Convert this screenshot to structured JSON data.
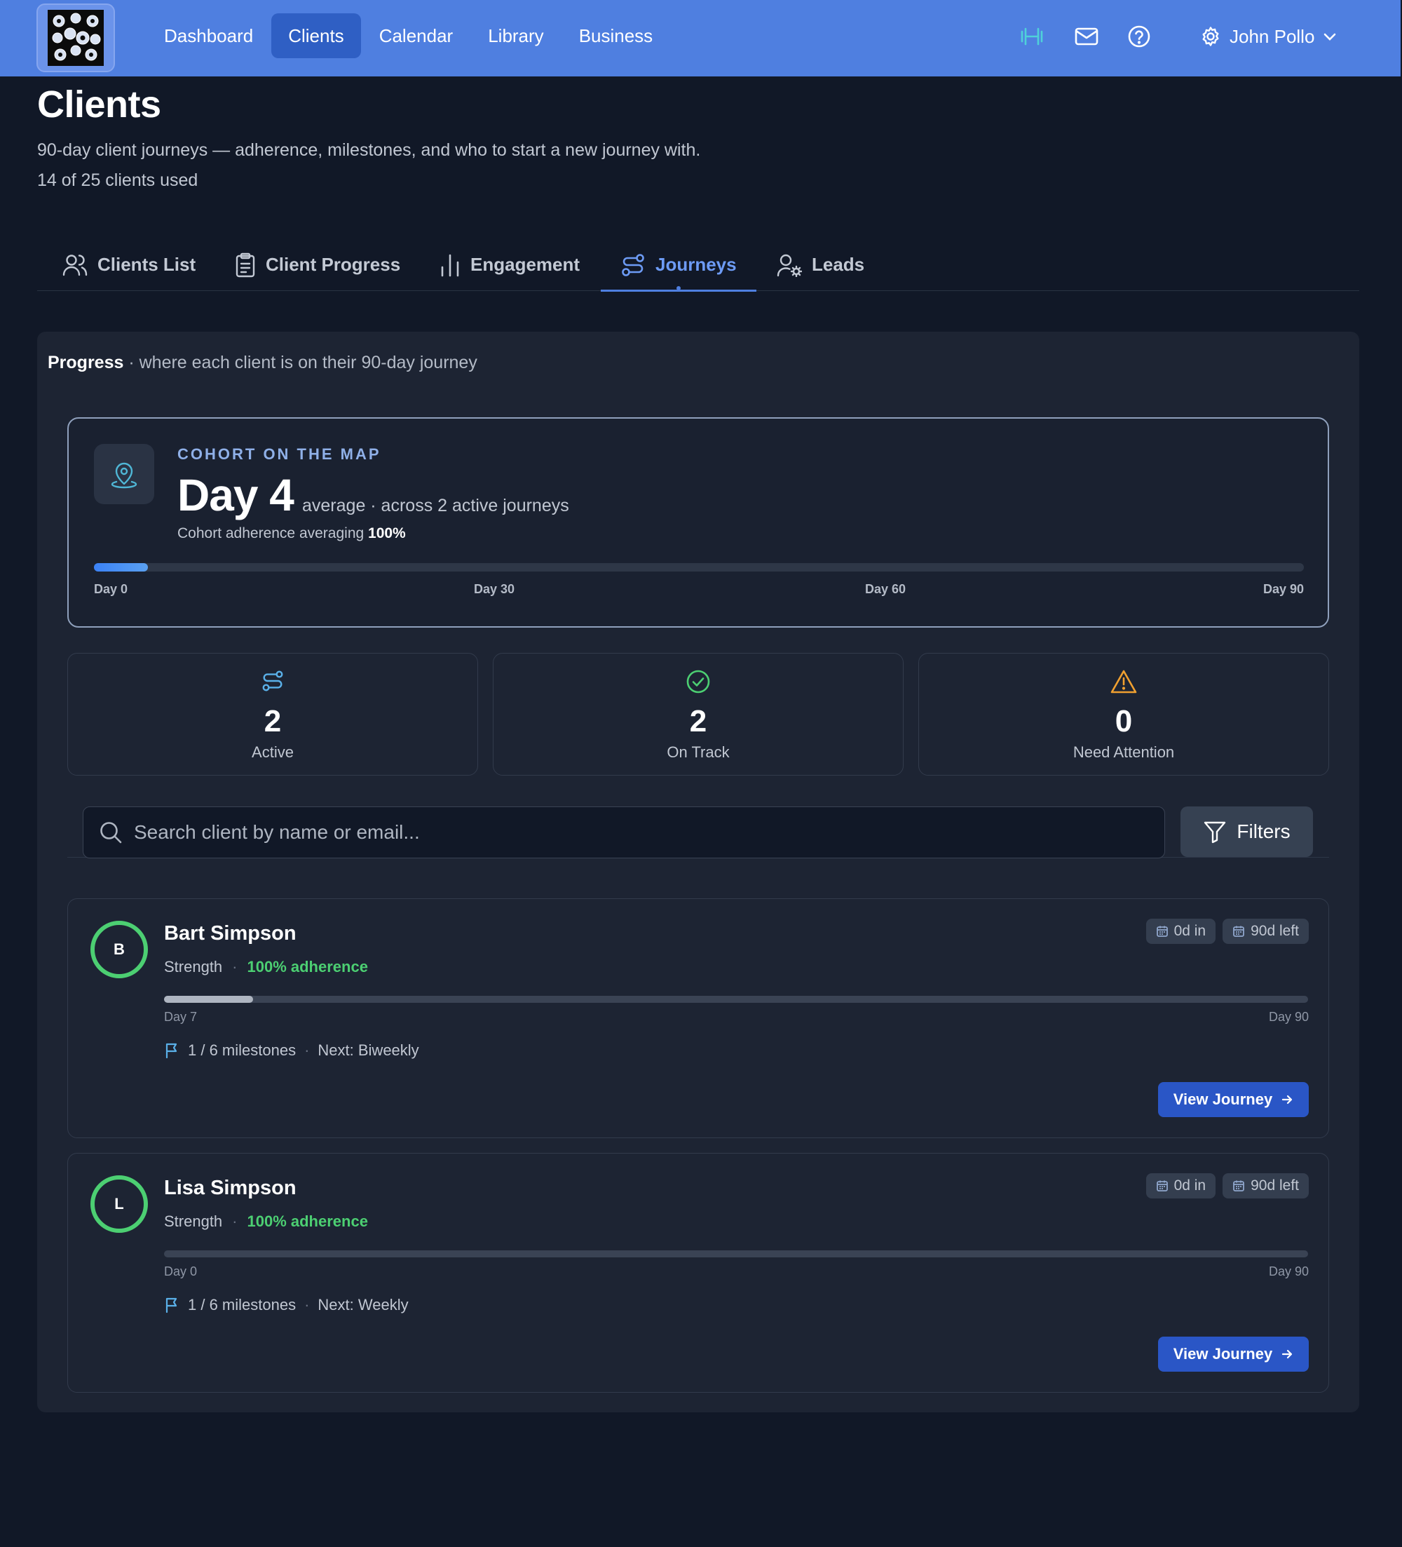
{
  "nav": {
    "items": [
      {
        "label": "Dashboard",
        "active": false
      },
      {
        "label": "Clients",
        "active": true
      },
      {
        "label": "Calendar",
        "active": false
      },
      {
        "label": "Library",
        "active": false
      },
      {
        "label": "Business",
        "active": false
      }
    ],
    "icons": [
      "dumbbell-icon",
      "mail-icon",
      "help-icon"
    ],
    "user": {
      "name": "John Pollo",
      "icon": "gear-icon"
    }
  },
  "header": {
    "title": "Clients",
    "subtitle": "90-day client journeys — adherence, milestones, and who to start a new journey with.",
    "usage": "14 of 25 clients used"
  },
  "tabs": [
    {
      "label": "Clients List",
      "icon": "users-icon",
      "active": false
    },
    {
      "label": "Client Progress",
      "icon": "clipboard-icon",
      "active": false
    },
    {
      "label": "Engagement",
      "icon": "bar-chart-icon",
      "active": false
    },
    {
      "label": "Journeys",
      "icon": "route-icon",
      "active": true
    },
    {
      "label": "Leads",
      "icon": "user-cog-icon",
      "active": false
    }
  ],
  "progress": {
    "heading_bold": "Progress",
    "heading_rest": " · where each client is on their 90-day journey"
  },
  "cohort": {
    "kicker": "COHORT ON THE MAP",
    "big": "Day 4",
    "meta": "average · across 2 active journeys",
    "adherence_prefix": "Cohort adherence averaging ",
    "adherence_value": "100%",
    "average_day": 4,
    "total_days": 90,
    "ticks": [
      "Day 0",
      "Day 30",
      "Day 60",
      "Day 90"
    ]
  },
  "stats": [
    {
      "value": "2",
      "label": "Active",
      "icon": "route-icon",
      "color": "#5ab0e8"
    },
    {
      "value": "2",
      "label": "On Track",
      "icon": "check-circle-icon",
      "color": "#4ccf72"
    },
    {
      "value": "0",
      "label": "Need Attention",
      "icon": "warning-icon",
      "color": "#f0a030"
    }
  ],
  "search": {
    "placeholder": "Search client by name or email...",
    "filters_label": "Filters"
  },
  "clients": [
    {
      "initial": "B",
      "name": "Bart Simpson",
      "program": "Strength",
      "adherence": "100% adherence",
      "days_in": "0d in",
      "days_left": "90d left",
      "current_day": 7,
      "day_start_label": "Day 7",
      "day_end_label": "Day 90",
      "milestones": "1 / 6 milestones",
      "next": "Next: Biweekly",
      "button": "View Journey"
    },
    {
      "initial": "L",
      "name": "Lisa Simpson",
      "program": "Strength",
      "adherence": "100% adherence",
      "days_in": "0d in",
      "days_left": "90d left",
      "current_day": 0,
      "day_start_label": "Day 0",
      "day_end_label": "Day 90",
      "milestones": "1 / 6 milestones",
      "next": "Next: Weekly",
      "button": "View Journey"
    }
  ]
}
